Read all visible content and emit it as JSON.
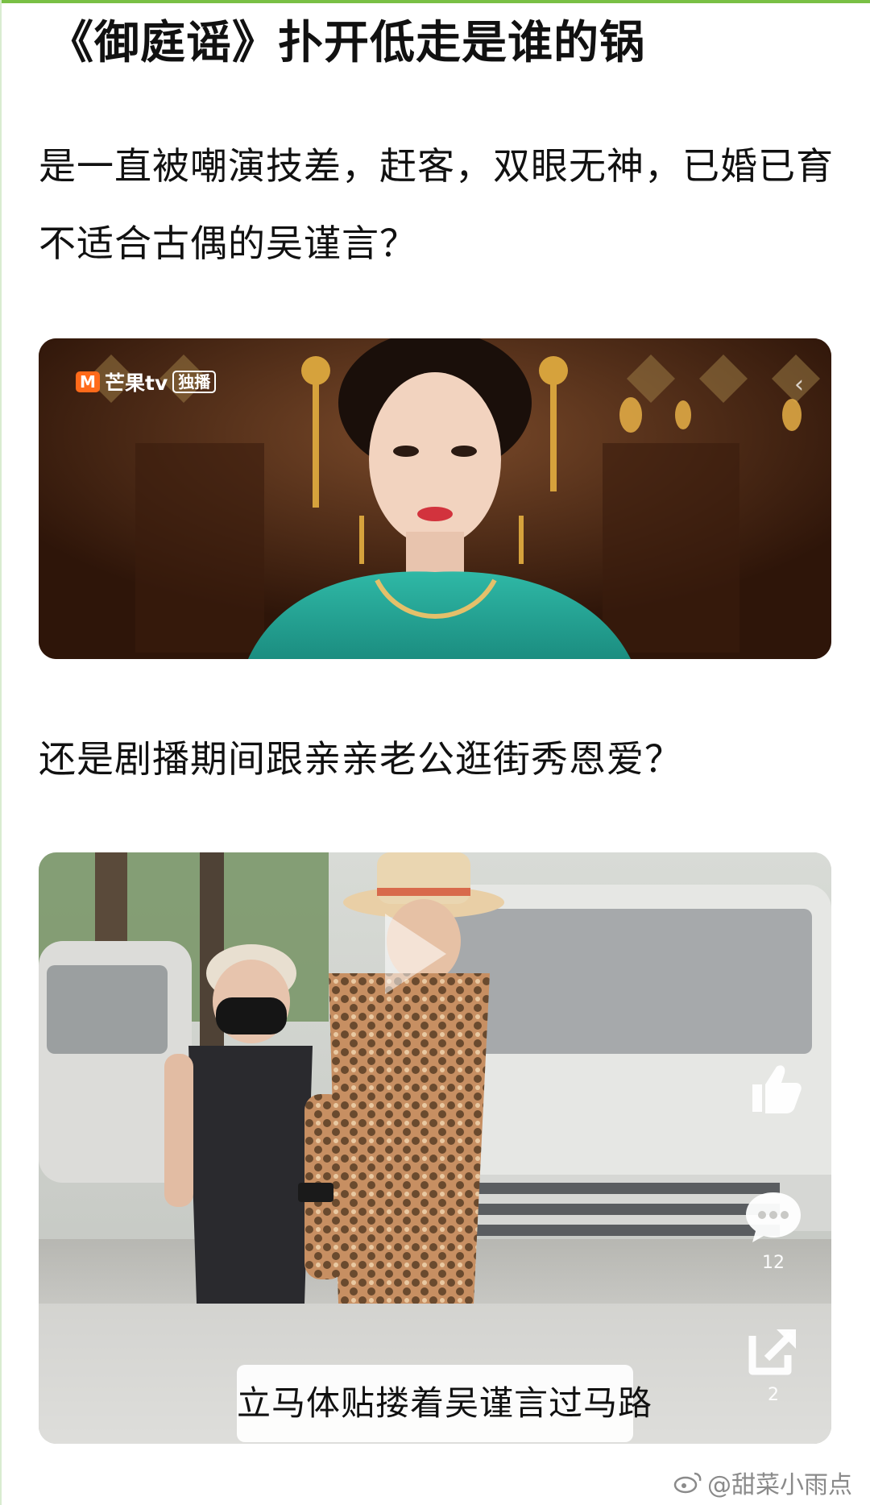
{
  "article": {
    "headline": "《御庭谣》扑开低走是谁的锅",
    "paragraph_1": "是一直被嘲演技差，赶客，双眼无神，已婚已育不适合古偶的吴谨言？",
    "paragraph_2": "还是剧播期间跟亲亲老公逛街秀恩爱？"
  },
  "image_1": {
    "logo_text": "芒果tv",
    "logo_badge": "独播"
  },
  "image_2": {
    "caption": "立马体贴搂着吴谨言过马路",
    "like_icon": "thumbs-up-icon",
    "comment_icon": "comment-bubble-icon",
    "comment_count": "12",
    "share_icon": "share-icon",
    "share_count": "2"
  },
  "watermark": {
    "text": "@甜菜小雨点",
    "icon": "weibo-icon"
  },
  "colors": {
    "accent_strip": "#79c045",
    "logo_orange": "#ff6a1a"
  }
}
